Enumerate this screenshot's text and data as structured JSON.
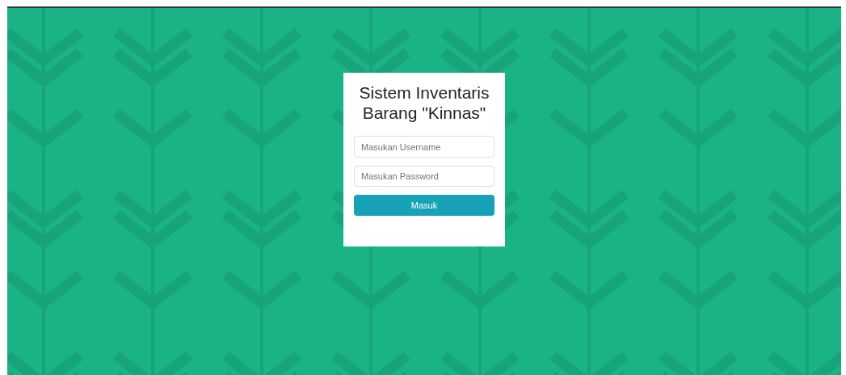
{
  "login": {
    "title": "Sistem Inventaris Barang \"Kinnas\"",
    "username": {
      "placeholder": "Masukan Username"
    },
    "password": {
      "placeholder": "Masukan Password"
    },
    "submit": "Masuk"
  }
}
